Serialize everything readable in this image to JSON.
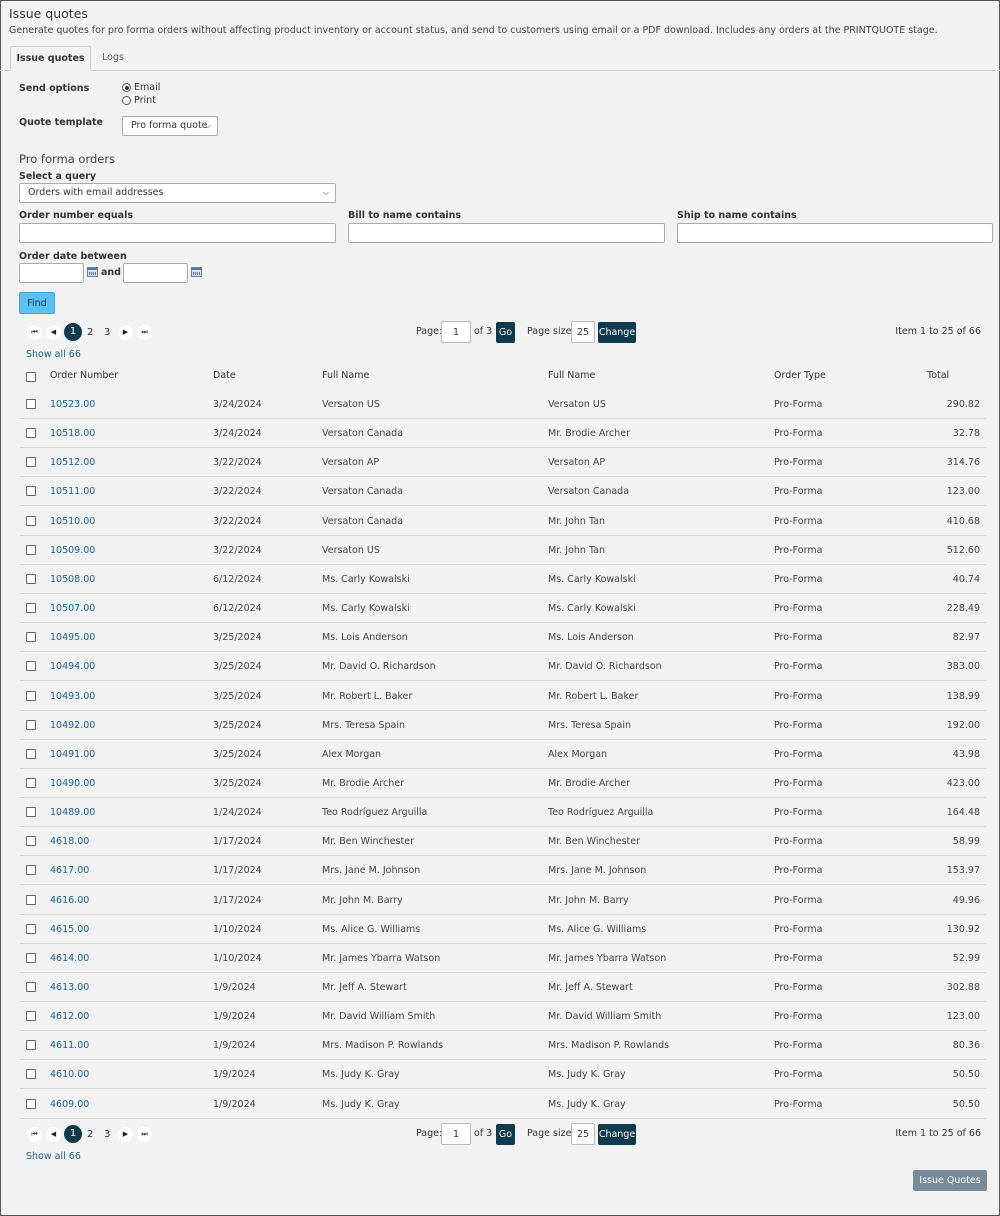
{
  "page": {
    "title": "Issue quotes",
    "description": "Generate quotes for pro forma orders without affecting product inventory or account status, and send to customers using email or a PDF download. Includes any orders at the PRINTQUOTE stage."
  },
  "tabs": [
    {
      "label": "Issue quotes",
      "active": true
    },
    {
      "label": "Logs",
      "active": false
    }
  ],
  "send_options": {
    "label": "Send options",
    "options": [
      {
        "label": "Email",
        "selected": true
      },
      {
        "label": "Print",
        "selected": false
      }
    ]
  },
  "quote_template": {
    "label": "Quote template",
    "value": "Pro forma quote"
  },
  "pro_forma": {
    "heading": "Pro forma orders",
    "query_label": "Select a query",
    "query_value": "Orders with email addresses",
    "order_number_label": "Order number equals",
    "bill_to_label": "Bill to name contains",
    "ship_to_label": "Ship to name contains",
    "order_date_label": "Order date between",
    "and_label": "and",
    "find_label": "Find"
  },
  "pager": {
    "pages": [
      "1",
      "2",
      "3"
    ],
    "current": "1",
    "page_label": "Page:",
    "page_value": "1",
    "of_label": "of 3",
    "go_label": "Go",
    "page_size_label": "Page size:",
    "page_size_value": "25",
    "change_label": "Change",
    "item_text": "Item 1 to 25 of 66",
    "show_all": "Show all 66"
  },
  "table": {
    "headers": [
      "Order Number",
      "Date",
      "Full Name",
      "Full Name",
      "Order Type",
      "Total"
    ],
    "rows": [
      [
        "10523.00",
        "3/24/2024",
        "Versaton US",
        "Versaton US",
        "Pro-Forma",
        "290.82"
      ],
      [
        "10518.00",
        "3/24/2024",
        "Versaton Canada",
        "Mr. Brodie Archer",
        "Pro-Forma",
        "32.78"
      ],
      [
        "10512.00",
        "3/22/2024",
        "Versaton AP",
        "Versaton AP",
        "Pro-Forma",
        "314.76"
      ],
      [
        "10511.00",
        "3/22/2024",
        "Versaton Canada",
        "Versaton Canada",
        "Pro-Forma",
        "123.00"
      ],
      [
        "10510.00",
        "3/22/2024",
        "Versaton Canada",
        "Mr. John Tan",
        "Pro-Forma",
        "410.68"
      ],
      [
        "10509.00",
        "3/22/2024",
        "Versaton US",
        "Mr. John Tan",
        "Pro-Forma",
        "512.60"
      ],
      [
        "10508.00",
        "6/12/2024",
        "Ms. Carly Kowalski",
        "Ms. Carly Kowalski",
        "Pro-Forma",
        "40.74"
      ],
      [
        "10507.00",
        "6/12/2024",
        "Ms. Carly Kowalski",
        "Ms. Carly Kowalski",
        "Pro-Forma",
        "228.49"
      ],
      [
        "10495.00",
        "3/25/2024",
        "Ms. Lois Anderson",
        "Ms. Lois Anderson",
        "Pro-Forma",
        "82.97"
      ],
      [
        "10494.00",
        "3/25/2024",
        "Mr. David O. Richardson",
        "Mr. David O. Richardson",
        "Pro-Forma",
        "383.00"
      ],
      [
        "10493.00",
        "3/25/2024",
        "Mr. Robert L. Baker",
        "Mr. Robert L. Baker",
        "Pro-Forma",
        "138.99"
      ],
      [
        "10492.00",
        "3/25/2024",
        "Mrs. Teresa Spain",
        "Mrs. Teresa Spain",
        "Pro-Forma",
        "192.00"
      ],
      [
        "10491.00",
        "3/25/2024",
        "Alex Morgan",
        "Alex Morgan",
        "Pro-Forma",
        "43.98"
      ],
      [
        "10490.00",
        "3/25/2024",
        "Mr. Brodie Archer",
        "Mr. Brodie Archer",
        "Pro-Forma",
        "423.00"
      ],
      [
        "10489.00",
        "1/24/2024",
        "Teo Rodríguez Arguilla",
        "Teo Rodríguez Arguilla",
        "Pro-Forma",
        "164.48"
      ],
      [
        "4618.00",
        "1/17/2024",
        "Mr. Ben Winchester",
        "Mr. Ben Winchester",
        "Pro-Forma",
        "58.99"
      ],
      [
        "4617.00",
        "1/17/2024",
        "Mrs. Jane M. Johnson",
        "Mrs. Jane M. Johnson",
        "Pro-Forma",
        "153.97"
      ],
      [
        "4616.00",
        "1/17/2024",
        "Mr. John M. Barry",
        "Mr. John M. Barry",
        "Pro-Forma",
        "49.96"
      ],
      [
        "4615.00",
        "1/10/2024",
        "Ms. Alice G. Williams",
        "Ms. Alice G. Williams",
        "Pro-Forma",
        "130.92"
      ],
      [
        "4614.00",
        "1/10/2024",
        "Mr. James Ybarra Watson",
        "Mr. James Ybarra Watson",
        "Pro-Forma",
        "52.99"
      ],
      [
        "4613.00",
        "1/9/2024",
        "Mr. Jeff A. Stewart",
        "Mr. Jeff A. Stewart",
        "Pro-Forma",
        "302.88"
      ],
      [
        "4612.00",
        "1/9/2024",
        "Mr. David William Smith",
        "Mr. David William Smith",
        "Pro-Forma",
        "123.00"
      ],
      [
        "4611.00",
        "1/9/2024",
        "Mrs. Madison P. Rowlands",
        "Mrs. Madison P. Rowlands",
        "Pro-Forma",
        "80.36"
      ],
      [
        "4610.00",
        "1/9/2024",
        "Ms. Judy K. Gray",
        "Ms. Judy K. Gray",
        "Pro-Forma",
        "50.50"
      ],
      [
        "4609.00",
        "1/9/2024",
        "Ms. Judy K. Gray",
        "Ms. Judy K. Gray",
        "Pro-Forma",
        "50.50"
      ]
    ]
  },
  "issue_button": "Issue Quotes",
  "colors": {
    "background": "#f2f2f2",
    "link": "#1a6096",
    "dark_button": "#0f3a4d",
    "find_button": "#5bc0f0",
    "issue_button": "#778b99"
  }
}
